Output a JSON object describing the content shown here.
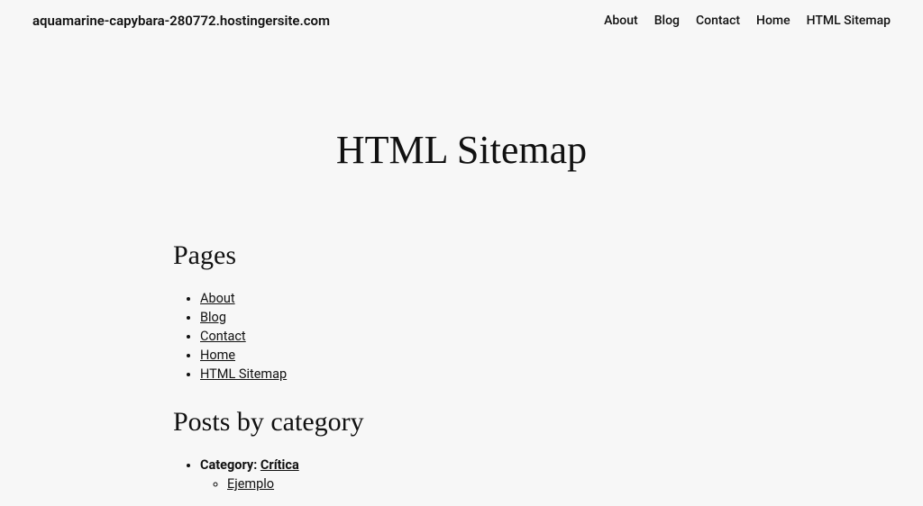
{
  "header": {
    "site_title": "aquamarine-capybara-280772.hostingersite.com",
    "nav": [
      {
        "label": "About"
      },
      {
        "label": "Blog"
      },
      {
        "label": "Contact"
      },
      {
        "label": "Home"
      },
      {
        "label": "HTML Sitemap"
      }
    ]
  },
  "page": {
    "title": "HTML Sitemap",
    "sections": {
      "pages": {
        "heading": "Pages",
        "items": [
          {
            "label": "About"
          },
          {
            "label": "Blog"
          },
          {
            "label": "Contact"
          },
          {
            "label": "Home"
          },
          {
            "label": "HTML Sitemap"
          }
        ]
      },
      "posts_by_category": {
        "heading": "Posts by category",
        "category_prefix": "Category: ",
        "categories": [
          {
            "name": "Crítica",
            "posts": [
              {
                "title": "Ejemplo"
              }
            ]
          }
        ]
      }
    }
  }
}
